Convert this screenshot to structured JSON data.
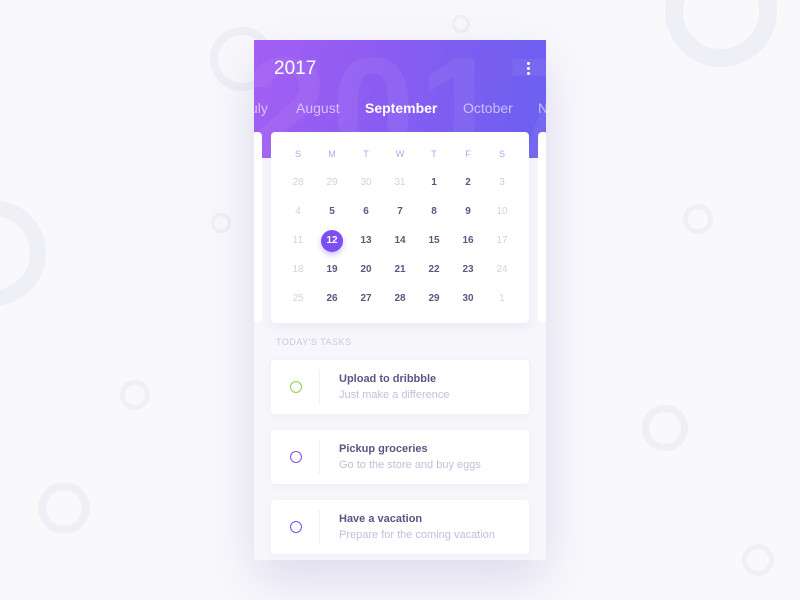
{
  "header": {
    "year": "2017",
    "watermark": "2017",
    "menu_icon": "more-vertical-icon"
  },
  "months": [
    {
      "label": "July",
      "display": "uly",
      "active": false
    },
    {
      "label": "August",
      "display": "August",
      "active": false
    },
    {
      "label": "September",
      "display": "September",
      "active": true
    },
    {
      "label": "October",
      "display": "October",
      "active": false
    },
    {
      "label": "November",
      "display": "N",
      "active": false
    }
  ],
  "calendar": {
    "weekdays": [
      "S",
      "M",
      "T",
      "W",
      "T",
      "F",
      "S"
    ],
    "selected_day": "12",
    "weeks": [
      [
        {
          "d": "28",
          "o": true
        },
        {
          "d": "29",
          "o": true
        },
        {
          "d": "30",
          "o": true
        },
        {
          "d": "31",
          "o": true
        },
        {
          "d": "1"
        },
        {
          "d": "2"
        },
        {
          "d": "3",
          "o": true
        }
      ],
      [
        {
          "d": "4",
          "o": true
        },
        {
          "d": "5"
        },
        {
          "d": "6"
        },
        {
          "d": "7"
        },
        {
          "d": "8"
        },
        {
          "d": "9"
        },
        {
          "d": "10",
          "o": true
        }
      ],
      [
        {
          "d": "11",
          "o": true
        },
        {
          "d": "12",
          "s": true
        },
        {
          "d": "13"
        },
        {
          "d": "14"
        },
        {
          "d": "15"
        },
        {
          "d": "16"
        },
        {
          "d": "17",
          "o": true
        }
      ],
      [
        {
          "d": "18",
          "o": true
        },
        {
          "d": "19"
        },
        {
          "d": "20"
        },
        {
          "d": "21"
        },
        {
          "d": "22"
        },
        {
          "d": "23"
        },
        {
          "d": "24",
          "o": true
        }
      ],
      [
        {
          "d": "25",
          "o": true
        },
        {
          "d": "26"
        },
        {
          "d": "27"
        },
        {
          "d": "28"
        },
        {
          "d": "29"
        },
        {
          "d": "30"
        },
        {
          "d": "1",
          "o": true
        }
      ]
    ]
  },
  "tasks": {
    "section_title": "TODAY'S TASKS",
    "items": [
      {
        "title": "Upload to dribbble",
        "subtitle": "Just make a difference",
        "check_color": "#8fd14a"
      },
      {
        "title": "Pickup groceries",
        "subtitle": "Go to the store and buy eggs",
        "check_color": "#7c4ff0"
      },
      {
        "title": "Have a vacation",
        "subtitle": "Prepare for the coming vacation",
        "check_color": "#7c4ff0"
      }
    ]
  },
  "colors": {
    "accent": "#7c4ff0",
    "gradient_start": "#a45ef3",
    "gradient_end": "#6a60f0",
    "done_green": "#8fd14a"
  }
}
